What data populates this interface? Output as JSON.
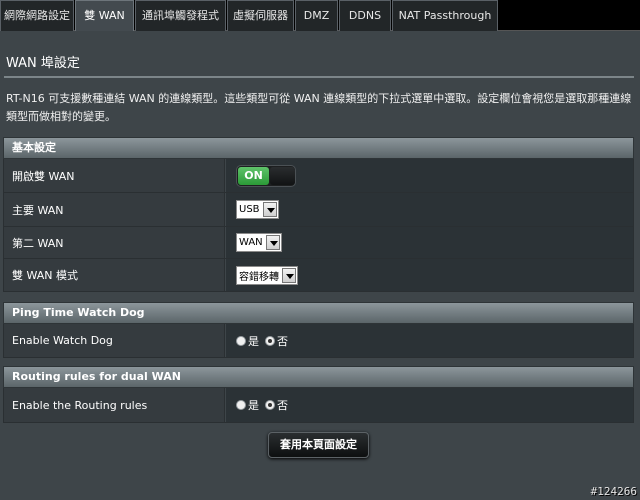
{
  "tabs": [
    {
      "label": "網際網路設定",
      "active": false
    },
    {
      "label": "雙 WAN",
      "active": true
    },
    {
      "label": "通訊埠觸發程式",
      "active": false
    },
    {
      "label": "虛擬伺服器",
      "active": false
    },
    {
      "label": "DMZ",
      "active": false
    },
    {
      "label": "DDNS",
      "active": false
    },
    {
      "label": "NAT Passthrough",
      "active": false
    }
  ],
  "page": {
    "title": "WAN 埠設定",
    "description": "RT-N16 可支援數種連結 WAN 的連線類型。這些類型可從 WAN 連線類型的下拉式選單中選取。設定欄位會視您是選取那種連線類型而做相對的變更。"
  },
  "basic": {
    "header": "基本設定",
    "dual_wan": {
      "label": "開啟雙 WAN",
      "toggle_on_text": "ON",
      "enabled": true
    },
    "primary_wan": {
      "label": "主要 WAN",
      "value": "USB"
    },
    "secondary_wan": {
      "label": "第二 WAN",
      "value": "WAN"
    },
    "mode": {
      "label": "雙 WAN 模式",
      "value": "容錯移轉"
    }
  },
  "watchdog": {
    "header": "Ping Time Watch Dog",
    "enable": {
      "label": "Enable Watch Dog",
      "yes": "是",
      "no": "否",
      "selected": "no"
    }
  },
  "routing": {
    "header": "Routing rules for dual WAN",
    "enable": {
      "label": "Enable the Routing rules",
      "yes": "是",
      "no": "否",
      "selected": "no"
    }
  },
  "apply_label": "套用本頁面設定",
  "watermark": "#124266"
}
